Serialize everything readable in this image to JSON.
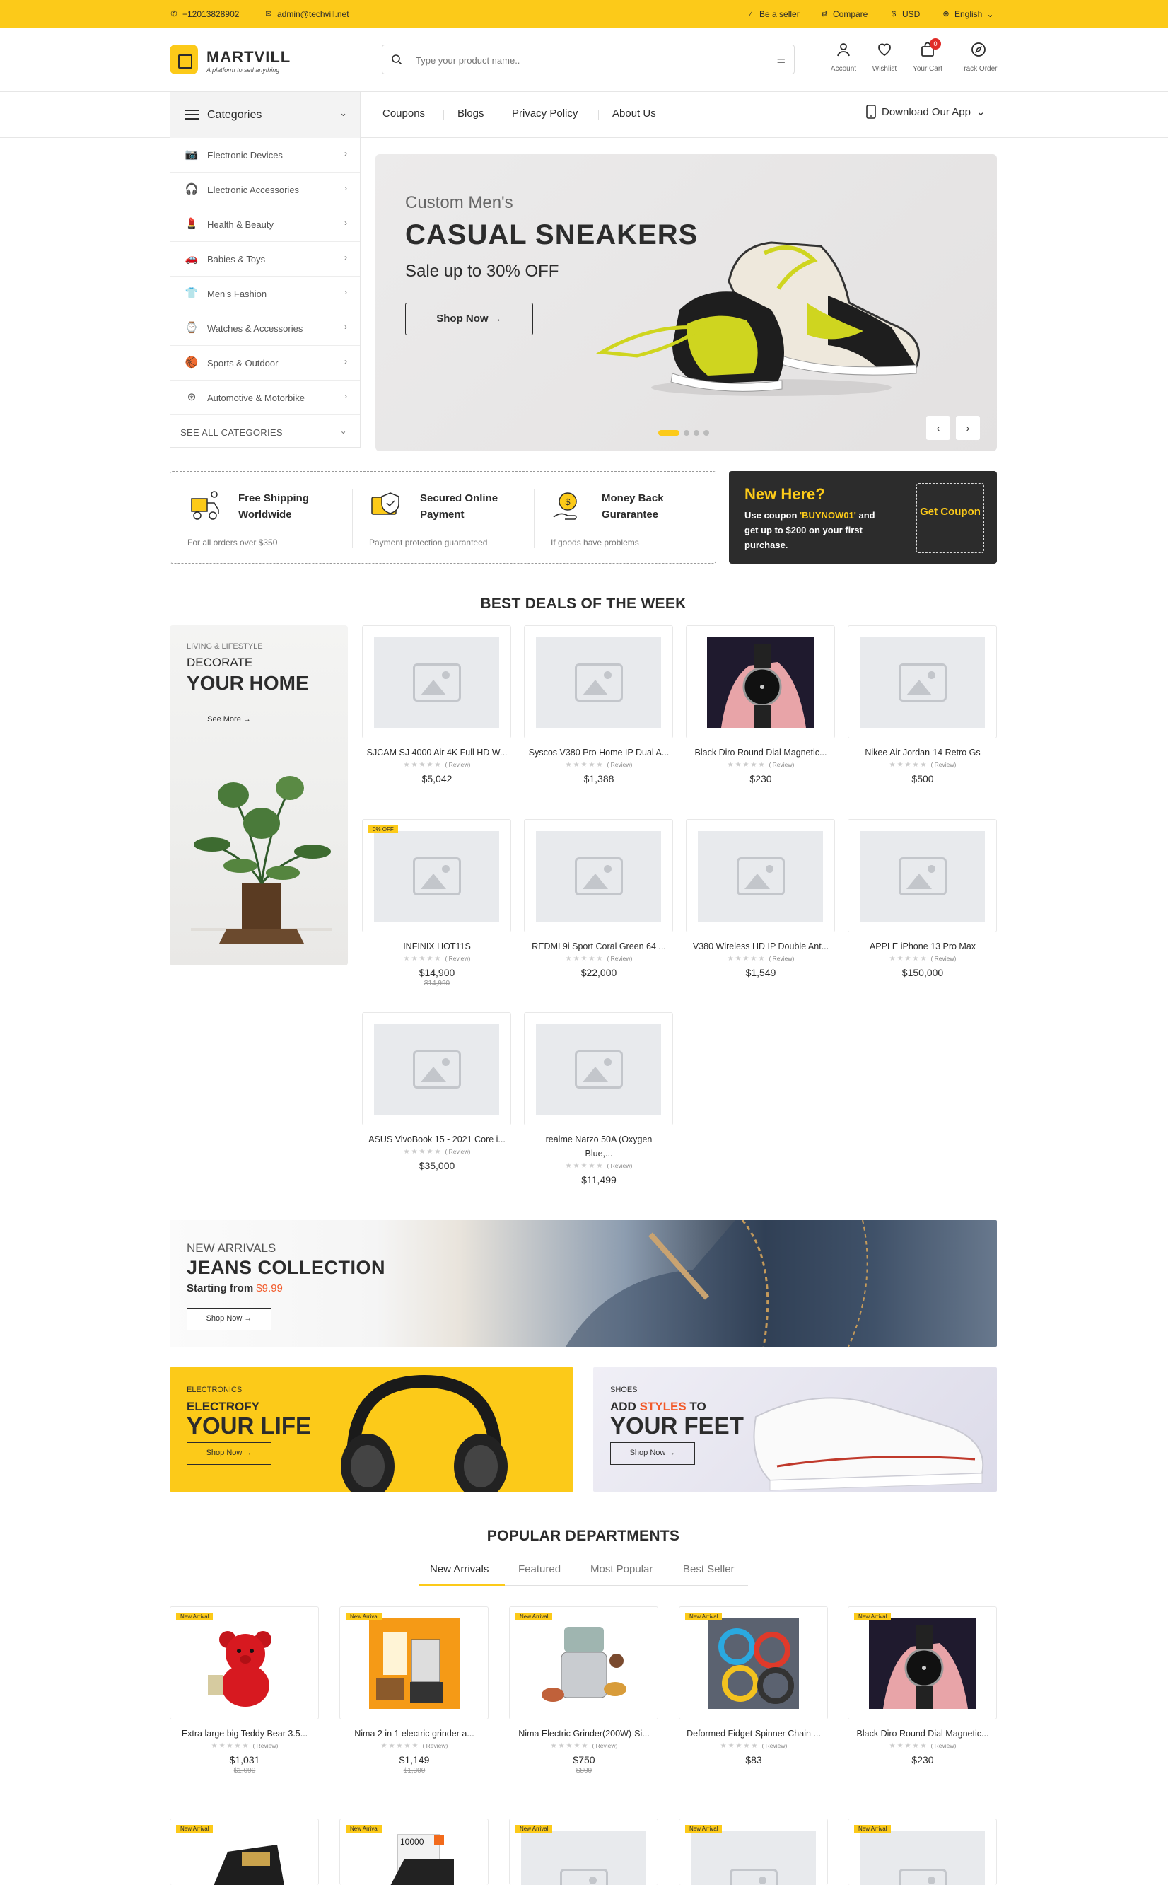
{
  "topbar": {
    "phone": "+12013828902",
    "email": "admin@techvill.net",
    "seller": "Be a seller",
    "compare": "Compare",
    "currency": "USD",
    "language": "English"
  },
  "header": {
    "brand": "MARTVILL",
    "tagline": "A platform to sell anything",
    "search_placeholder": "Type your product name..",
    "icons": [
      {
        "label": "Account",
        "icon": "user-icon"
      },
      {
        "label": "Wishlist",
        "icon": "heart-icon"
      },
      {
        "label": "Your Cart",
        "icon": "bag-icon"
      },
      {
        "label": "Track Order",
        "icon": "compass-icon"
      }
    ],
    "cart_count": "0"
  },
  "nav": {
    "categories_label": "Categories",
    "links": [
      "Coupons",
      "Blogs",
      "Privacy Policy",
      "About Us"
    ],
    "download": "Download Our App"
  },
  "sidebar": {
    "items": [
      {
        "label": "Electronic Devices",
        "icon": "camera-icon"
      },
      {
        "label": "Electronic Accessories",
        "icon": "headphone-icon"
      },
      {
        "label": "Health & Beauty",
        "icon": "lipstick-icon"
      },
      {
        "label": "Babies & Toys",
        "icon": "toy-car-icon"
      },
      {
        "label": "Men's Fashion",
        "icon": "shirt-icon"
      },
      {
        "label": "Watches & Accessories",
        "icon": "watch-icon"
      },
      {
        "label": "Sports & Outdoor",
        "icon": "ball-icon"
      },
      {
        "label": "Automotive & Motorbike",
        "icon": "steering-icon"
      }
    ],
    "see_all": "SEE ALL CATEGORIES"
  },
  "hero": {
    "pre": "Custom Men's",
    "title": "CASUAL SNEAKERS",
    "sub": "Sale up to 30% OFF",
    "button": "Shop Now →"
  },
  "features": [
    {
      "title": "Free Shipping Worldwide",
      "sub": "For all orders over $350"
    },
    {
      "title": "Secured Online Payment",
      "sub": "Payment protection guaranteed"
    },
    {
      "title": "Money Back Gurarantee",
      "sub": "If goods have problems"
    }
  ],
  "coupon": {
    "title": "New Here?",
    "text_a": "Use coupon ",
    "code": "'BUYNOW01'",
    "text_b": " and get up to $200 on your first purchase.",
    "button": "Get Coupon"
  },
  "deals": {
    "title": "BEST DEALS OF THE WEEK",
    "banner": {
      "pre": "LIVING & LIFESTYLE",
      "line1": "DECORATE",
      "line2": "YOUR HOME",
      "button": "See More →"
    },
    "products": [
      {
        "name": "SJCAM SJ 4000 Air 4K Full HD W...",
        "price": "$5,042",
        "old": "",
        "tag": ""
      },
      {
        "name": "Syscos V380 Pro Home IP Dual A...",
        "price": "$1,388",
        "old": "",
        "tag": ""
      },
      {
        "name": "Black Diro Round Dial Magnetic...",
        "price": "$230",
        "old": "",
        "tag": ""
      },
      {
        "name": "Nikee Air Jordan-14 Retro Gs",
        "price": "$500",
        "old": "",
        "tag": ""
      },
      {
        "name": "INFINIX HOT11S",
        "price": "$14,900",
        "old": "$14,990",
        "tag": "0% OFF"
      },
      {
        "name": "REDMI 9i Sport Coral Green 64 ...",
        "price": "$22,000",
        "old": "",
        "tag": ""
      },
      {
        "name": "V380 Wireless HD IP Double Ant...",
        "price": "$1,549",
        "old": "",
        "tag": ""
      },
      {
        "name": "APPLE iPhone 13 Pro Max",
        "price": "$150,000",
        "old": "",
        "tag": ""
      },
      {
        "name": "ASUS VivoBook 15 - 2021 Core i...",
        "price": "$35,000",
        "old": "",
        "tag": ""
      },
      {
        "name": "realme Narzo 50A (Oxygen Blue,...",
        "price": "$11,499",
        "old": "",
        "tag": ""
      }
    ],
    "stars": "★★★★★",
    "review": "( Review)"
  },
  "jeans": {
    "pre": "NEW ARRIVALS",
    "title": "JEANS COLLECTION",
    "from": "Starting from ",
    "price": "$9.99",
    "button": "Shop Now →"
  },
  "promo_left": {
    "pre": "ELECTRONICS",
    "line1": "ELECTROFY",
    "line2": "YOUR LIFE",
    "button": "Shop Now →"
  },
  "promo_right": {
    "pre": "SHOES",
    "line1a": "ADD ",
    "line1b": "STYLES",
    "line1c": " TO",
    "line2": "YOUR FEET",
    "button": "Shop Now →"
  },
  "popular": {
    "title": "POPULAR DEPARTMENTS",
    "tabs": [
      "New Arrivals",
      "Featured",
      "Most Popular",
      "Best Seller"
    ],
    "products": [
      {
        "name": "Extra large big Teddy Bear 3.5...",
        "price": "$1,031",
        "old": "$1,090",
        "tag": "New Arrival"
      },
      {
        "name": "Nima 2 in 1 electric grinder a...",
        "price": "$1,149",
        "old": "$1,300",
        "tag": "New Arrival"
      },
      {
        "name": "Nima Electric Grinder(200W)-Si...",
        "price": "$750",
        "old": "$800",
        "tag": "New Arrival"
      },
      {
        "name": "Deformed Fidget Spinner Chain ...",
        "price": "$83",
        "old": "",
        "tag": "New Arrival"
      },
      {
        "name": "Black Diro Round Dial Magnetic...",
        "price": "$230",
        "old": "",
        "tag": "New Arrival"
      }
    ],
    "row2_tags": [
      "New Arrival",
      "New Arrival",
      "New Arrival",
      "New Arrival",
      "New Arrival"
    ],
    "powerbank_text": "10000"
  },
  "colors": {
    "accent": "#fcca19",
    "dark": "#2c2c2c",
    "sale": "#f25a2a"
  }
}
